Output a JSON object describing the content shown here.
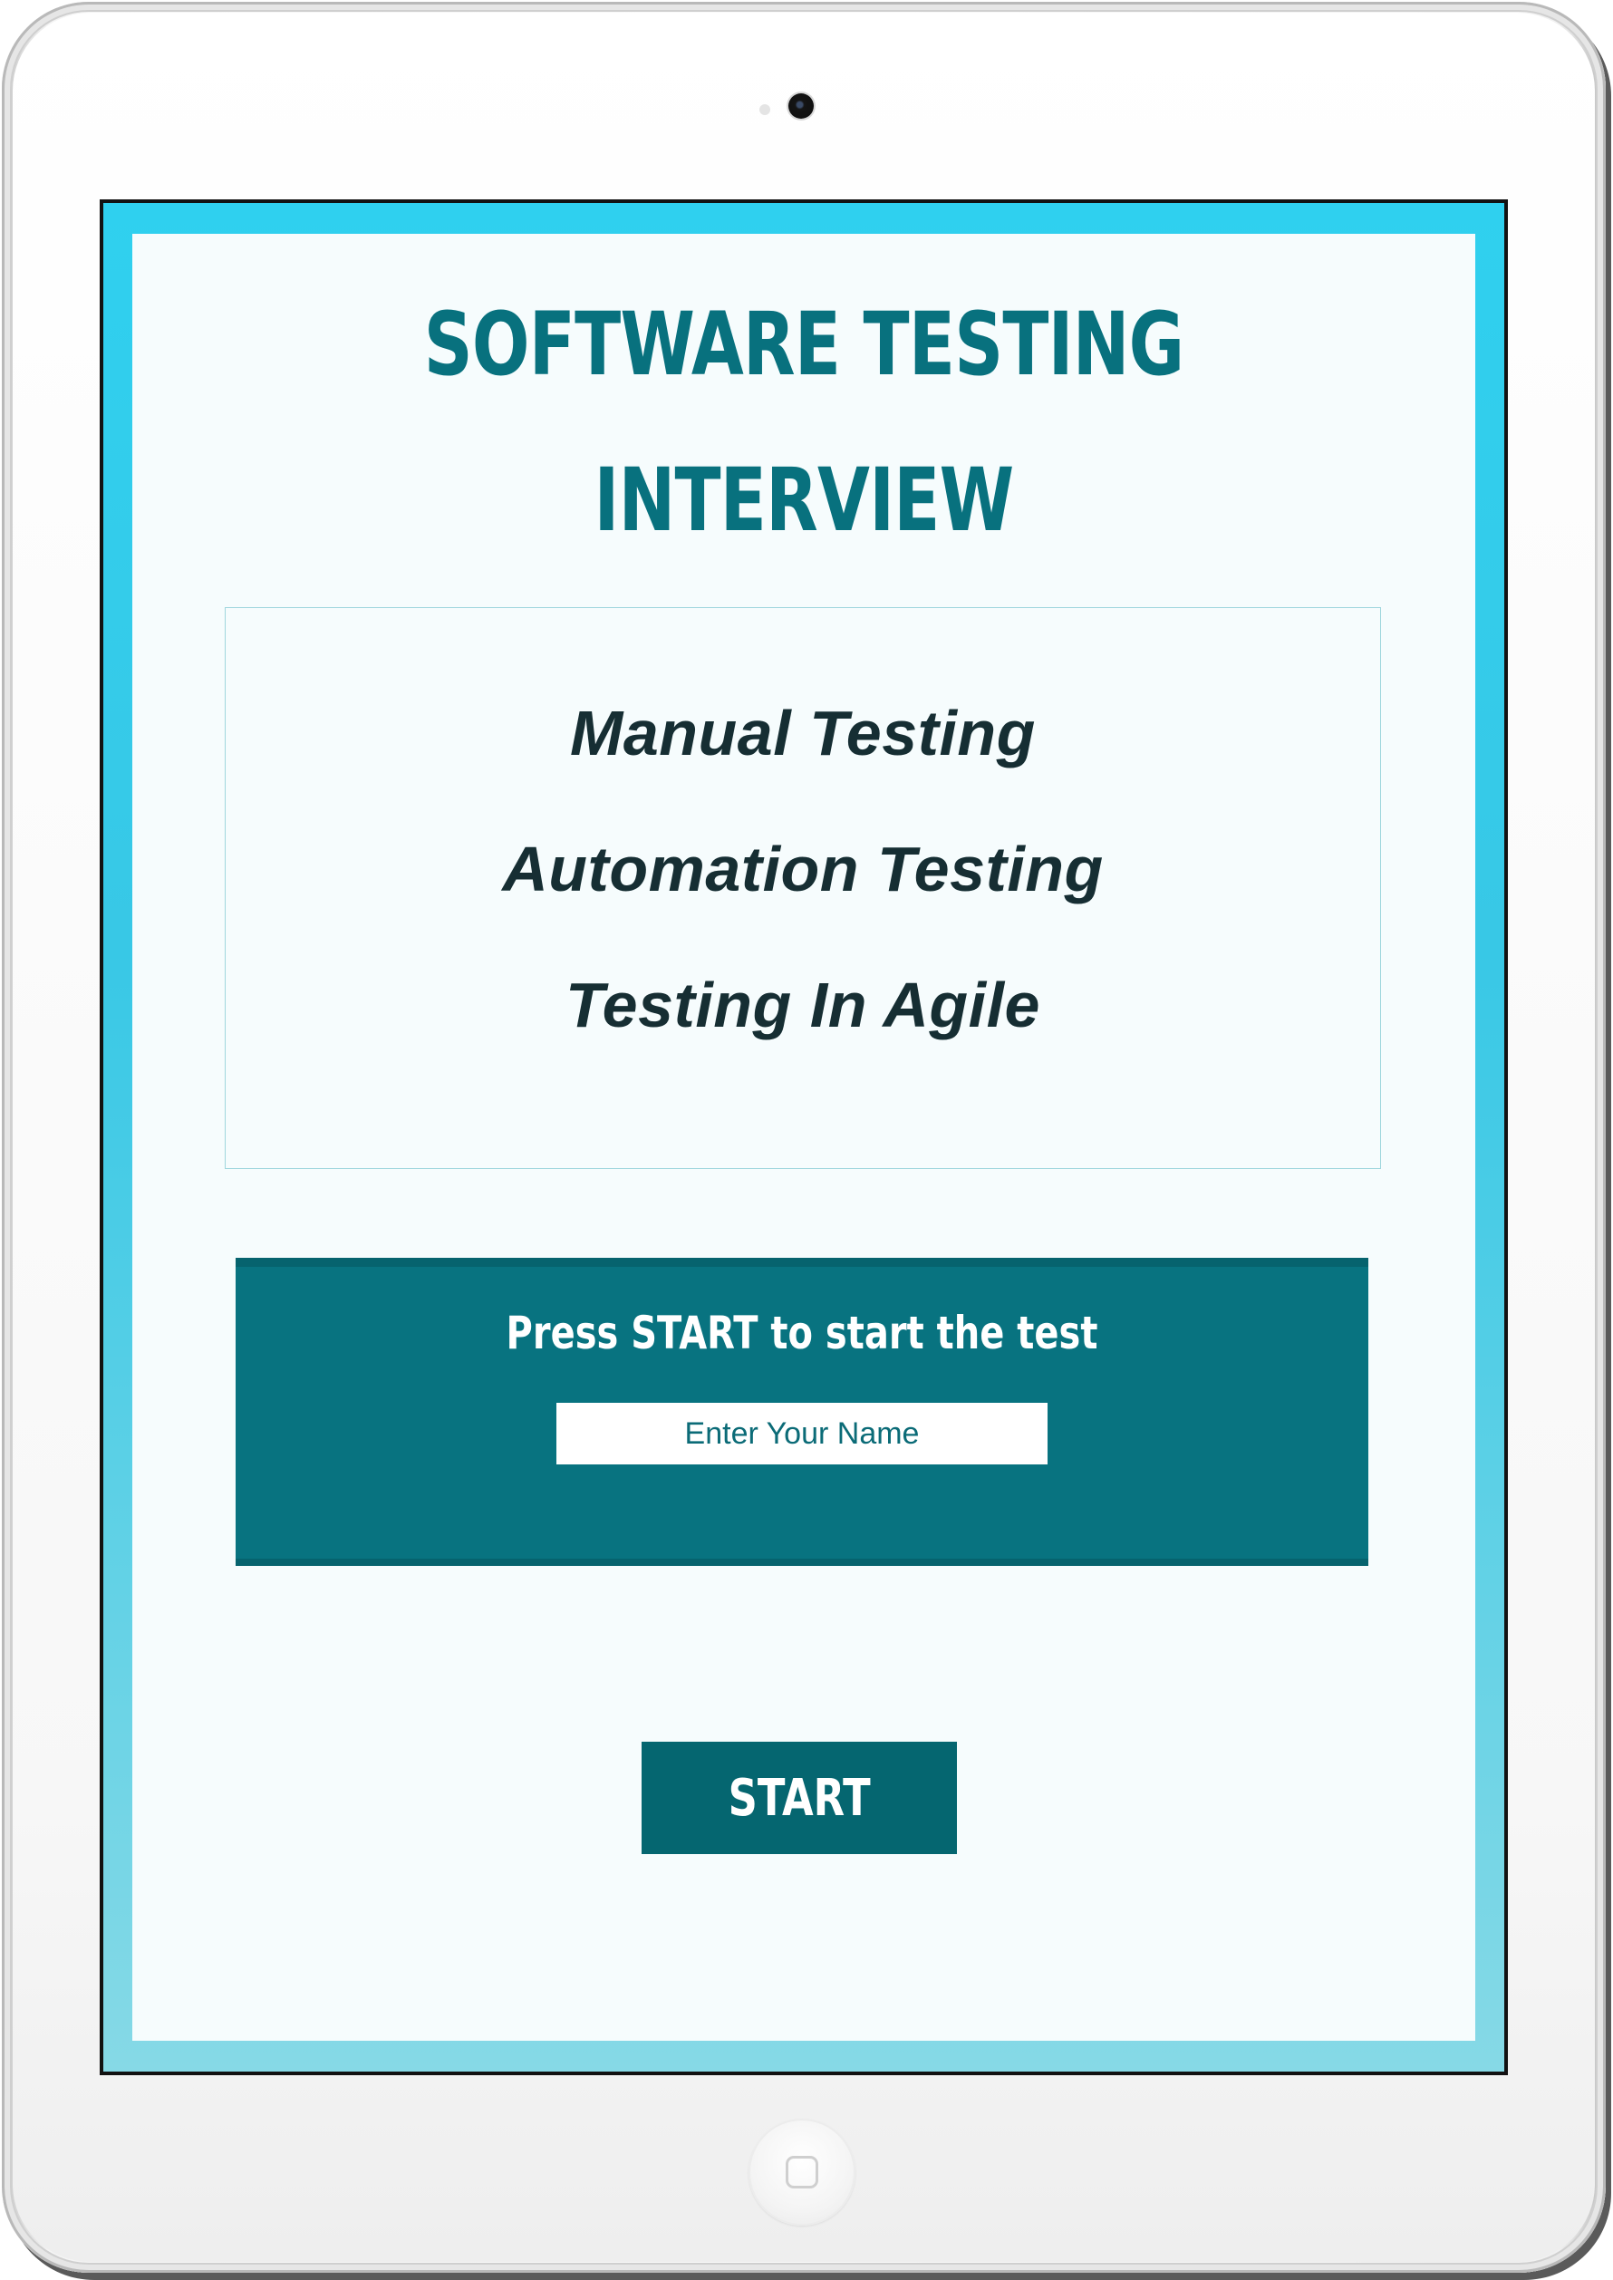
{
  "header": {
    "title_line1": "SOFTWARE TESTING",
    "title_line2": "INTERVIEW"
  },
  "topics": [
    {
      "label": "Manual Testing"
    },
    {
      "label": "Automation Testing"
    },
    {
      "label": "Testing In Agile"
    }
  ],
  "start_panel": {
    "heading": "Press START to start the test",
    "name_input": {
      "value": "",
      "placeholder": "Enter Your Name"
    }
  },
  "start_button": {
    "label": "START"
  },
  "device": {
    "camera_icon": "camera-icon",
    "home_icon": "home-button-icon"
  },
  "colors": {
    "accent": "#08717e",
    "screen_frame": "#2fd0ef",
    "panel": "#087380",
    "button": "#056670",
    "topic_text": "#162e33"
  }
}
